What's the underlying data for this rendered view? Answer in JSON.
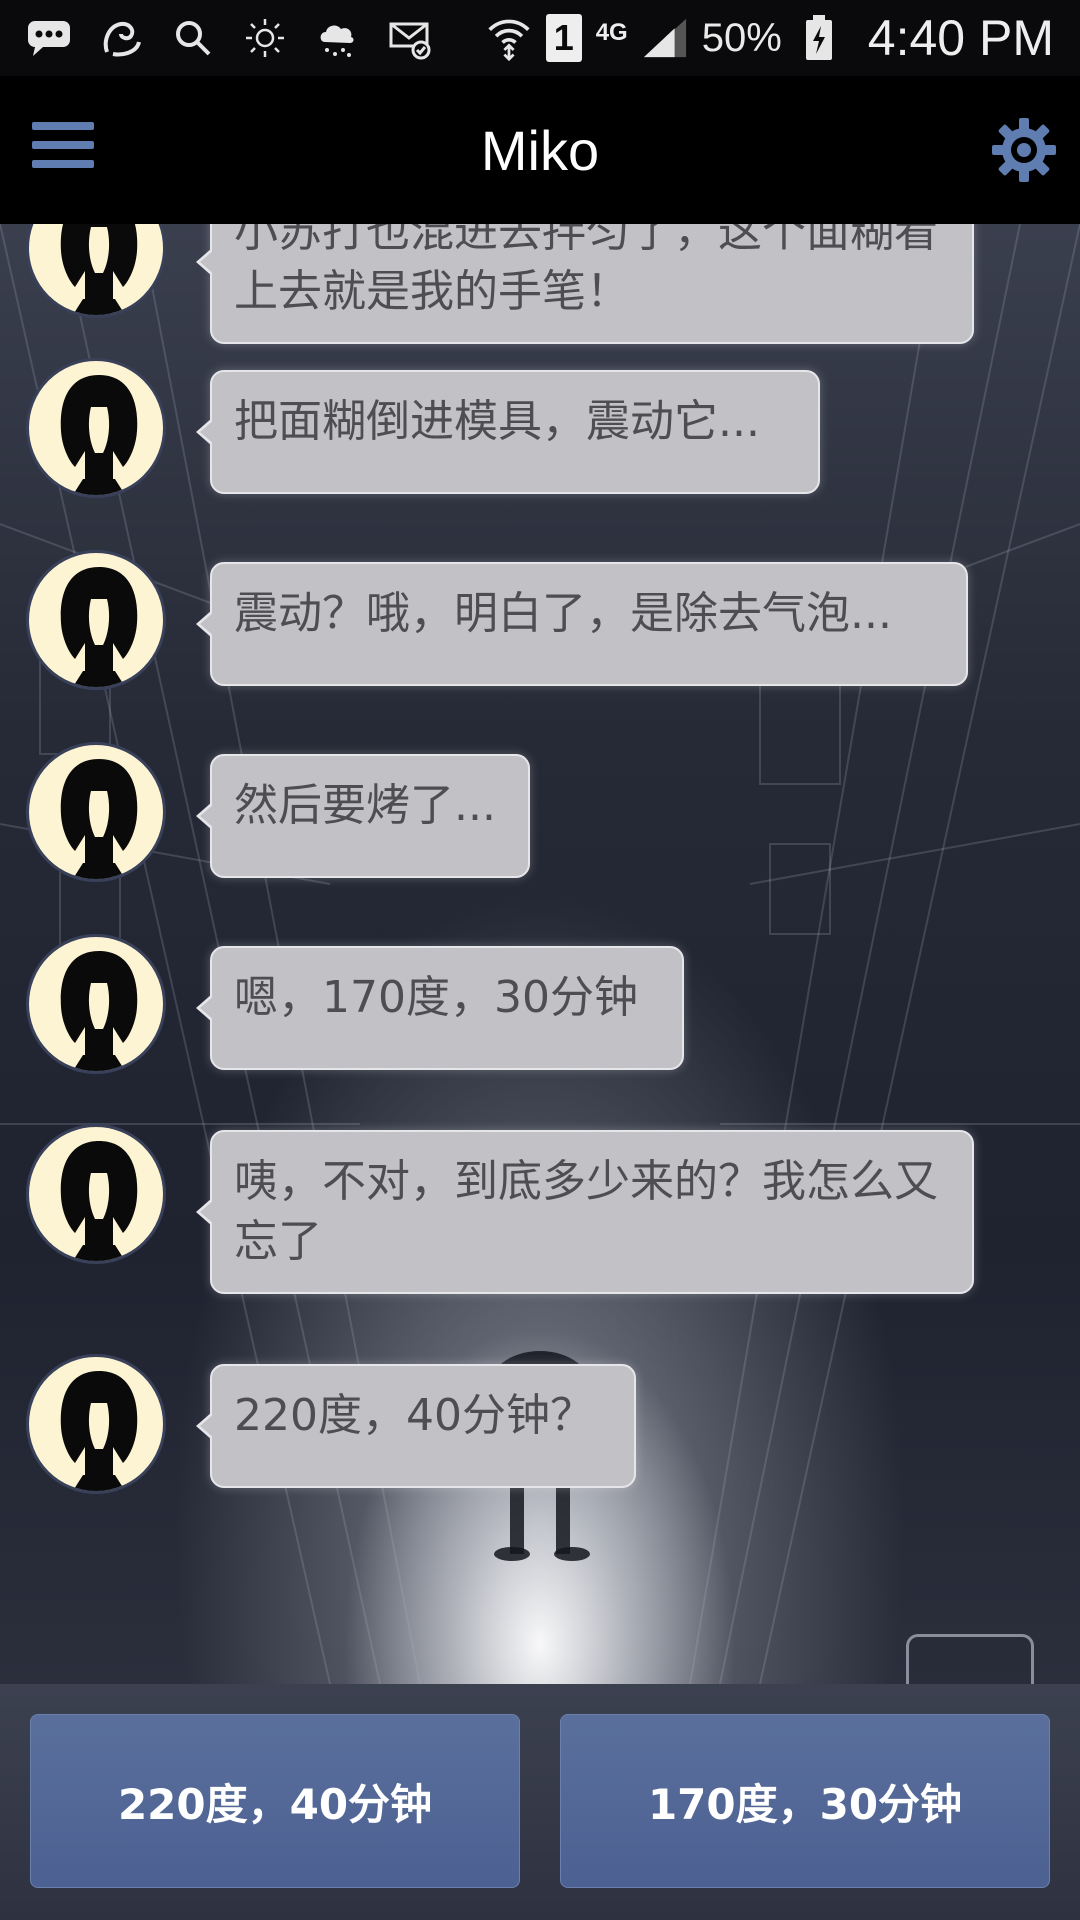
{
  "status_bar": {
    "icons": [
      "message-icon",
      "uc-browser-icon",
      "search-icon",
      "sun-icon",
      "cloud-rain-icon",
      "mail-check-icon",
      "wifi-icon",
      "sim-icon",
      "signal-icon",
      "battery-charging-icon"
    ],
    "sim_label": "1",
    "network": "4G",
    "battery": "50%",
    "time": "4:40 PM"
  },
  "app_bar": {
    "title": "Miko",
    "menu_icon": "hamburger-menu-icon",
    "settings_icon": "gear-icon",
    "accent_color": "#5f7db1"
  },
  "messages": [
    {
      "sender": "Miko",
      "text": "小苏打也混进去拌匀了，这个面糊看上去就是我的手笔！"
    },
    {
      "sender": "Miko",
      "text": "把面糊倒进模具，震动它..."
    },
    {
      "sender": "Miko",
      "text": "震动？哦，明白了，是除去气泡..."
    },
    {
      "sender": "Miko",
      "text": "然后要烤了..."
    },
    {
      "sender": "Miko",
      "text": "嗯，170度，30分钟"
    },
    {
      "sender": "Miko",
      "text": "咦，不对，到底多少来的？我怎么又忘了"
    },
    {
      "sender": "Miko",
      "text": "220度，40分钟？"
    }
  ],
  "choices": [
    {
      "label": "220度，40分钟"
    },
    {
      "label": "170度，30分钟"
    }
  ]
}
